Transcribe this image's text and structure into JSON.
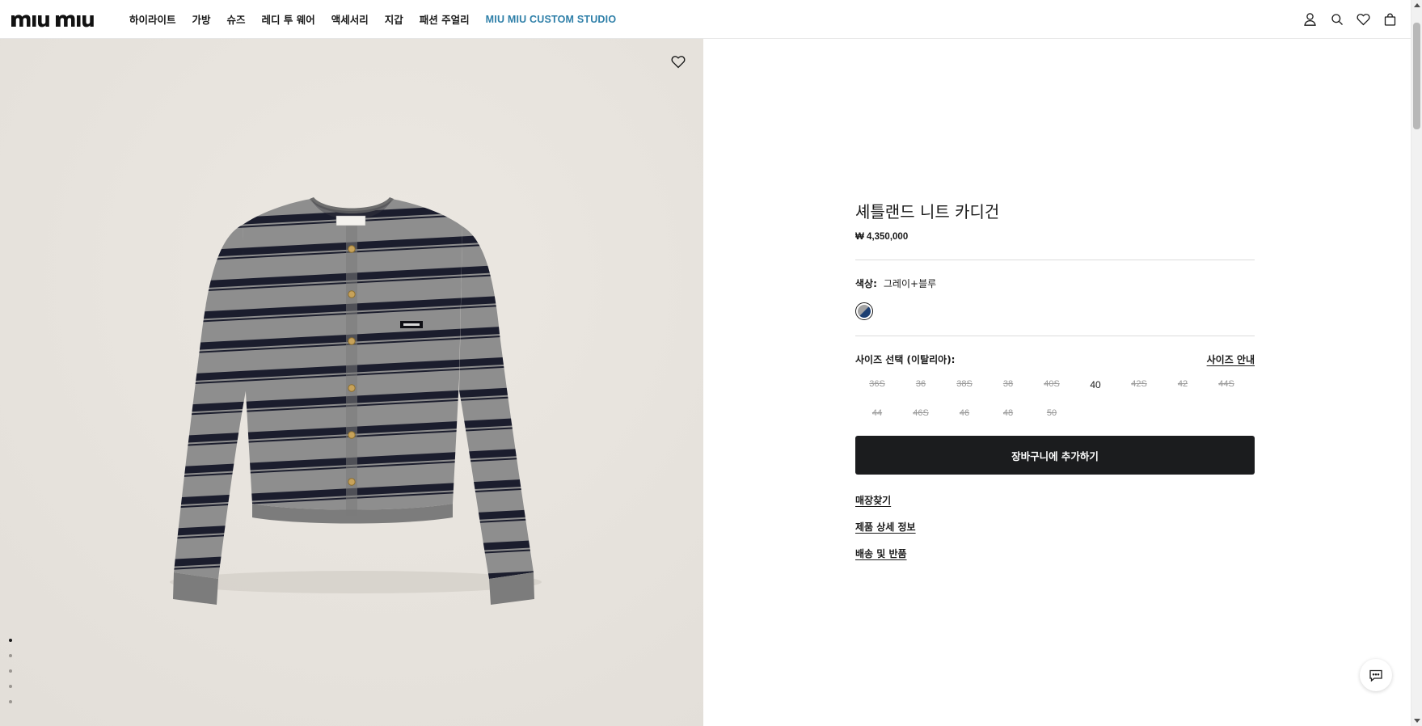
{
  "header": {
    "logo_text": "miu miu",
    "nav": [
      {
        "label": "하이라이트",
        "accent": false
      },
      {
        "label": "가방",
        "accent": false
      },
      {
        "label": "슈즈",
        "accent": false
      },
      {
        "label": "레디 투 웨어",
        "accent": false
      },
      {
        "label": "액세서리",
        "accent": false
      },
      {
        "label": "지갑",
        "accent": false
      },
      {
        "label": "패션 주얼리",
        "accent": false
      },
      {
        "label": "MIU MIU CUSTOM STUDIO",
        "accent": true
      }
    ],
    "icons": [
      "account-icon",
      "search-icon",
      "wishlist-icon",
      "bag-icon"
    ]
  },
  "gallery": {
    "background": "#e7e3dd",
    "image_count": 5,
    "active_index": 0,
    "wishlist_icon": "heart-icon"
  },
  "product": {
    "title": "셰틀랜드 니트 카디건",
    "price": "₩ 4,350,000",
    "color_label": "색상:",
    "color_value": "그레이+블루",
    "swatch_colors": [
      "#a3a3a3",
      "#1c3f73"
    ],
    "size_label": "사이즈 선택 (이탈리아):",
    "size_guide": "사이즈 안내",
    "sizes": [
      {
        "label": "36S",
        "available": false
      },
      {
        "label": "36",
        "available": false
      },
      {
        "label": "38S",
        "available": false
      },
      {
        "label": "38",
        "available": false
      },
      {
        "label": "40S",
        "available": false
      },
      {
        "label": "40",
        "available": true
      },
      {
        "label": "42S",
        "available": false
      },
      {
        "label": "42",
        "available": false
      },
      {
        "label": "44S",
        "available": false
      },
      {
        "label": "44",
        "available": false
      },
      {
        "label": "46S",
        "available": false
      },
      {
        "label": "46",
        "available": false
      },
      {
        "label": "48",
        "available": false
      },
      {
        "label": "50",
        "available": false
      }
    ],
    "add_to_cart": "장바구니에 추가하기",
    "links": [
      "매장찾기",
      "제품 상세 정보",
      "배송 및 반품"
    ]
  },
  "chat": {
    "icon": "chat-icon"
  }
}
